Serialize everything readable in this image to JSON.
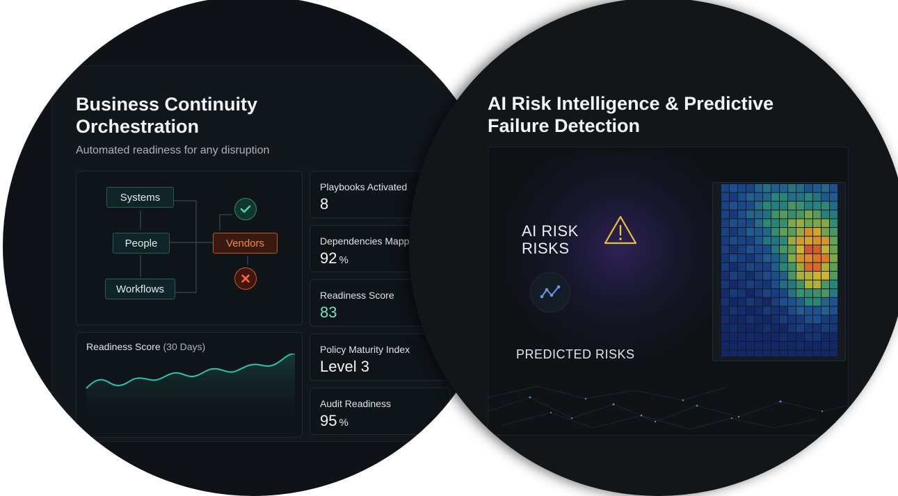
{
  "left_panel": {
    "title_line1": "Business Continuity",
    "title_line2": "Orchestration",
    "subtitle": "Automated readiness for any disruption",
    "diagram": {
      "nodes": [
        "Systems",
        "People",
        "Workflows",
        "Vendors"
      ],
      "status_icons": [
        "check-icon",
        "close-icon"
      ]
    },
    "chart_label": "Readiness Score",
    "chart_period": "(30 Days)",
    "metrics": [
      {
        "label": "Playbooks Activated",
        "value": "8",
        "unit": ""
      },
      {
        "label": "Dependencies Mapped",
        "value": "92",
        "unit": "%"
      },
      {
        "label": "Readiness Score",
        "value": "83",
        "unit": ""
      },
      {
        "label": "Policy Maturity Index",
        "value": "Level 3",
        "unit": ""
      },
      {
        "label": "Audit Readiness",
        "value": "95",
        "unit": "%"
      }
    ]
  },
  "right_panel": {
    "title_line1": "AI Risk Intelligence & Predictive",
    "title_line2": "Failure Detection",
    "risk_heading_line1": "AI RISK",
    "risk_heading_line2": "RISKS",
    "predicted_label": "PREDICTED RISKS",
    "icons": [
      "warning-icon",
      "trend-icon"
    ]
  },
  "colors": {
    "accent_teal": "#2bc4b0",
    "vendor_orange": "#f08a3a",
    "warning_yellow": "#e9c33b",
    "error_red": "#e0502c"
  }
}
